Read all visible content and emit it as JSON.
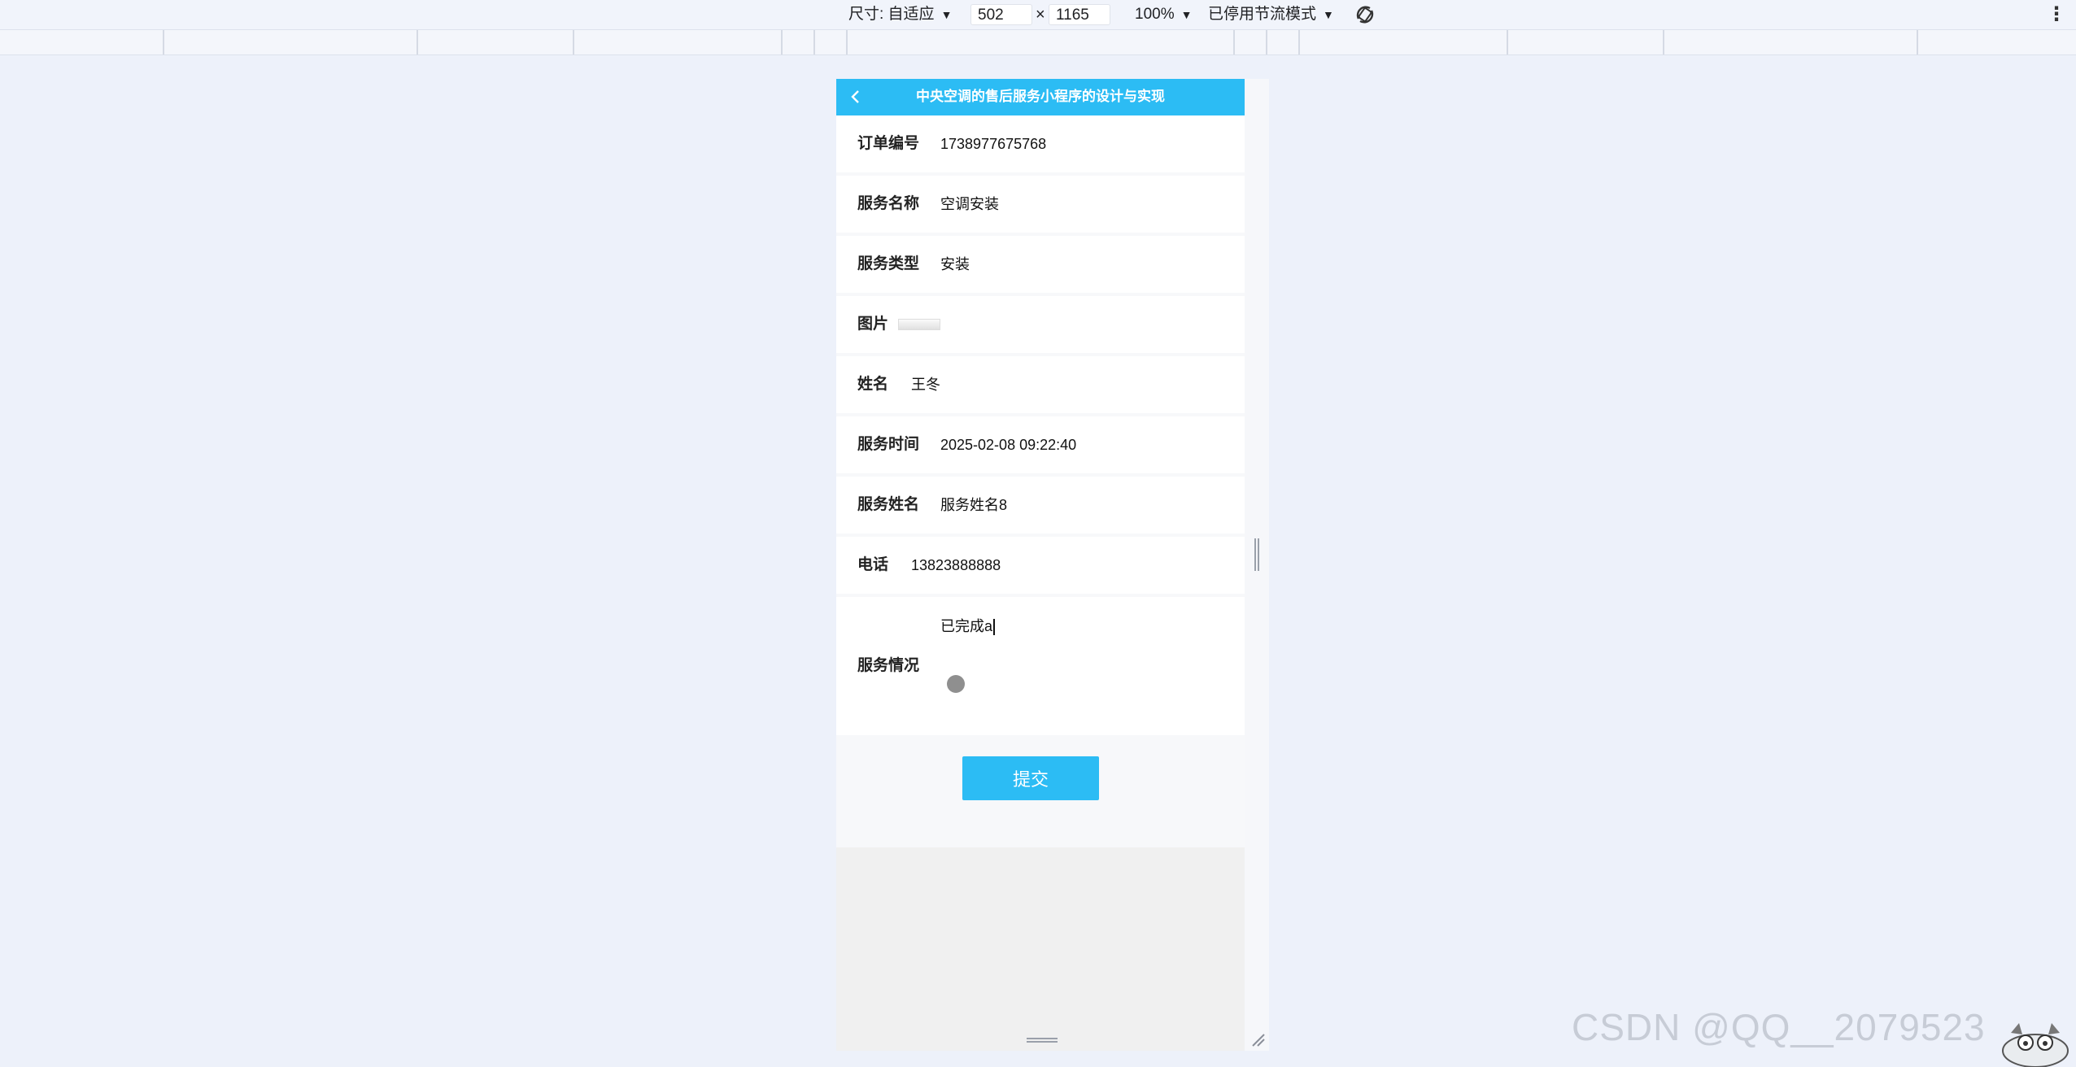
{
  "devtools": {
    "dimensions_label": "尺寸: 自适应",
    "width_value": "502",
    "times": "×",
    "height_value": "1165",
    "zoom": "100%",
    "throttle": "已停用节流模式"
  },
  "app": {
    "title": "中央空调的售后服务小程序的设计与实现",
    "fields": [
      {
        "label": "订单编号",
        "value": "1738977675768"
      },
      {
        "label": "服务名称",
        "value": "空调安装"
      },
      {
        "label": "服务类型",
        "value": "安装"
      },
      {
        "label": "图片",
        "value": ""
      },
      {
        "label": "姓名",
        "value": "王冬"
      },
      {
        "label": "服务时间",
        "value": "2025-02-08 09:22:40"
      },
      {
        "label": "服务姓名",
        "value": "服务姓名8"
      },
      {
        "label": "电话",
        "value": "13823888888"
      }
    ],
    "status": {
      "label": "服务情况",
      "value": "已完成a"
    },
    "submit_label": "提交"
  },
  "watermark": "CSDN @QQ__2079523"
}
